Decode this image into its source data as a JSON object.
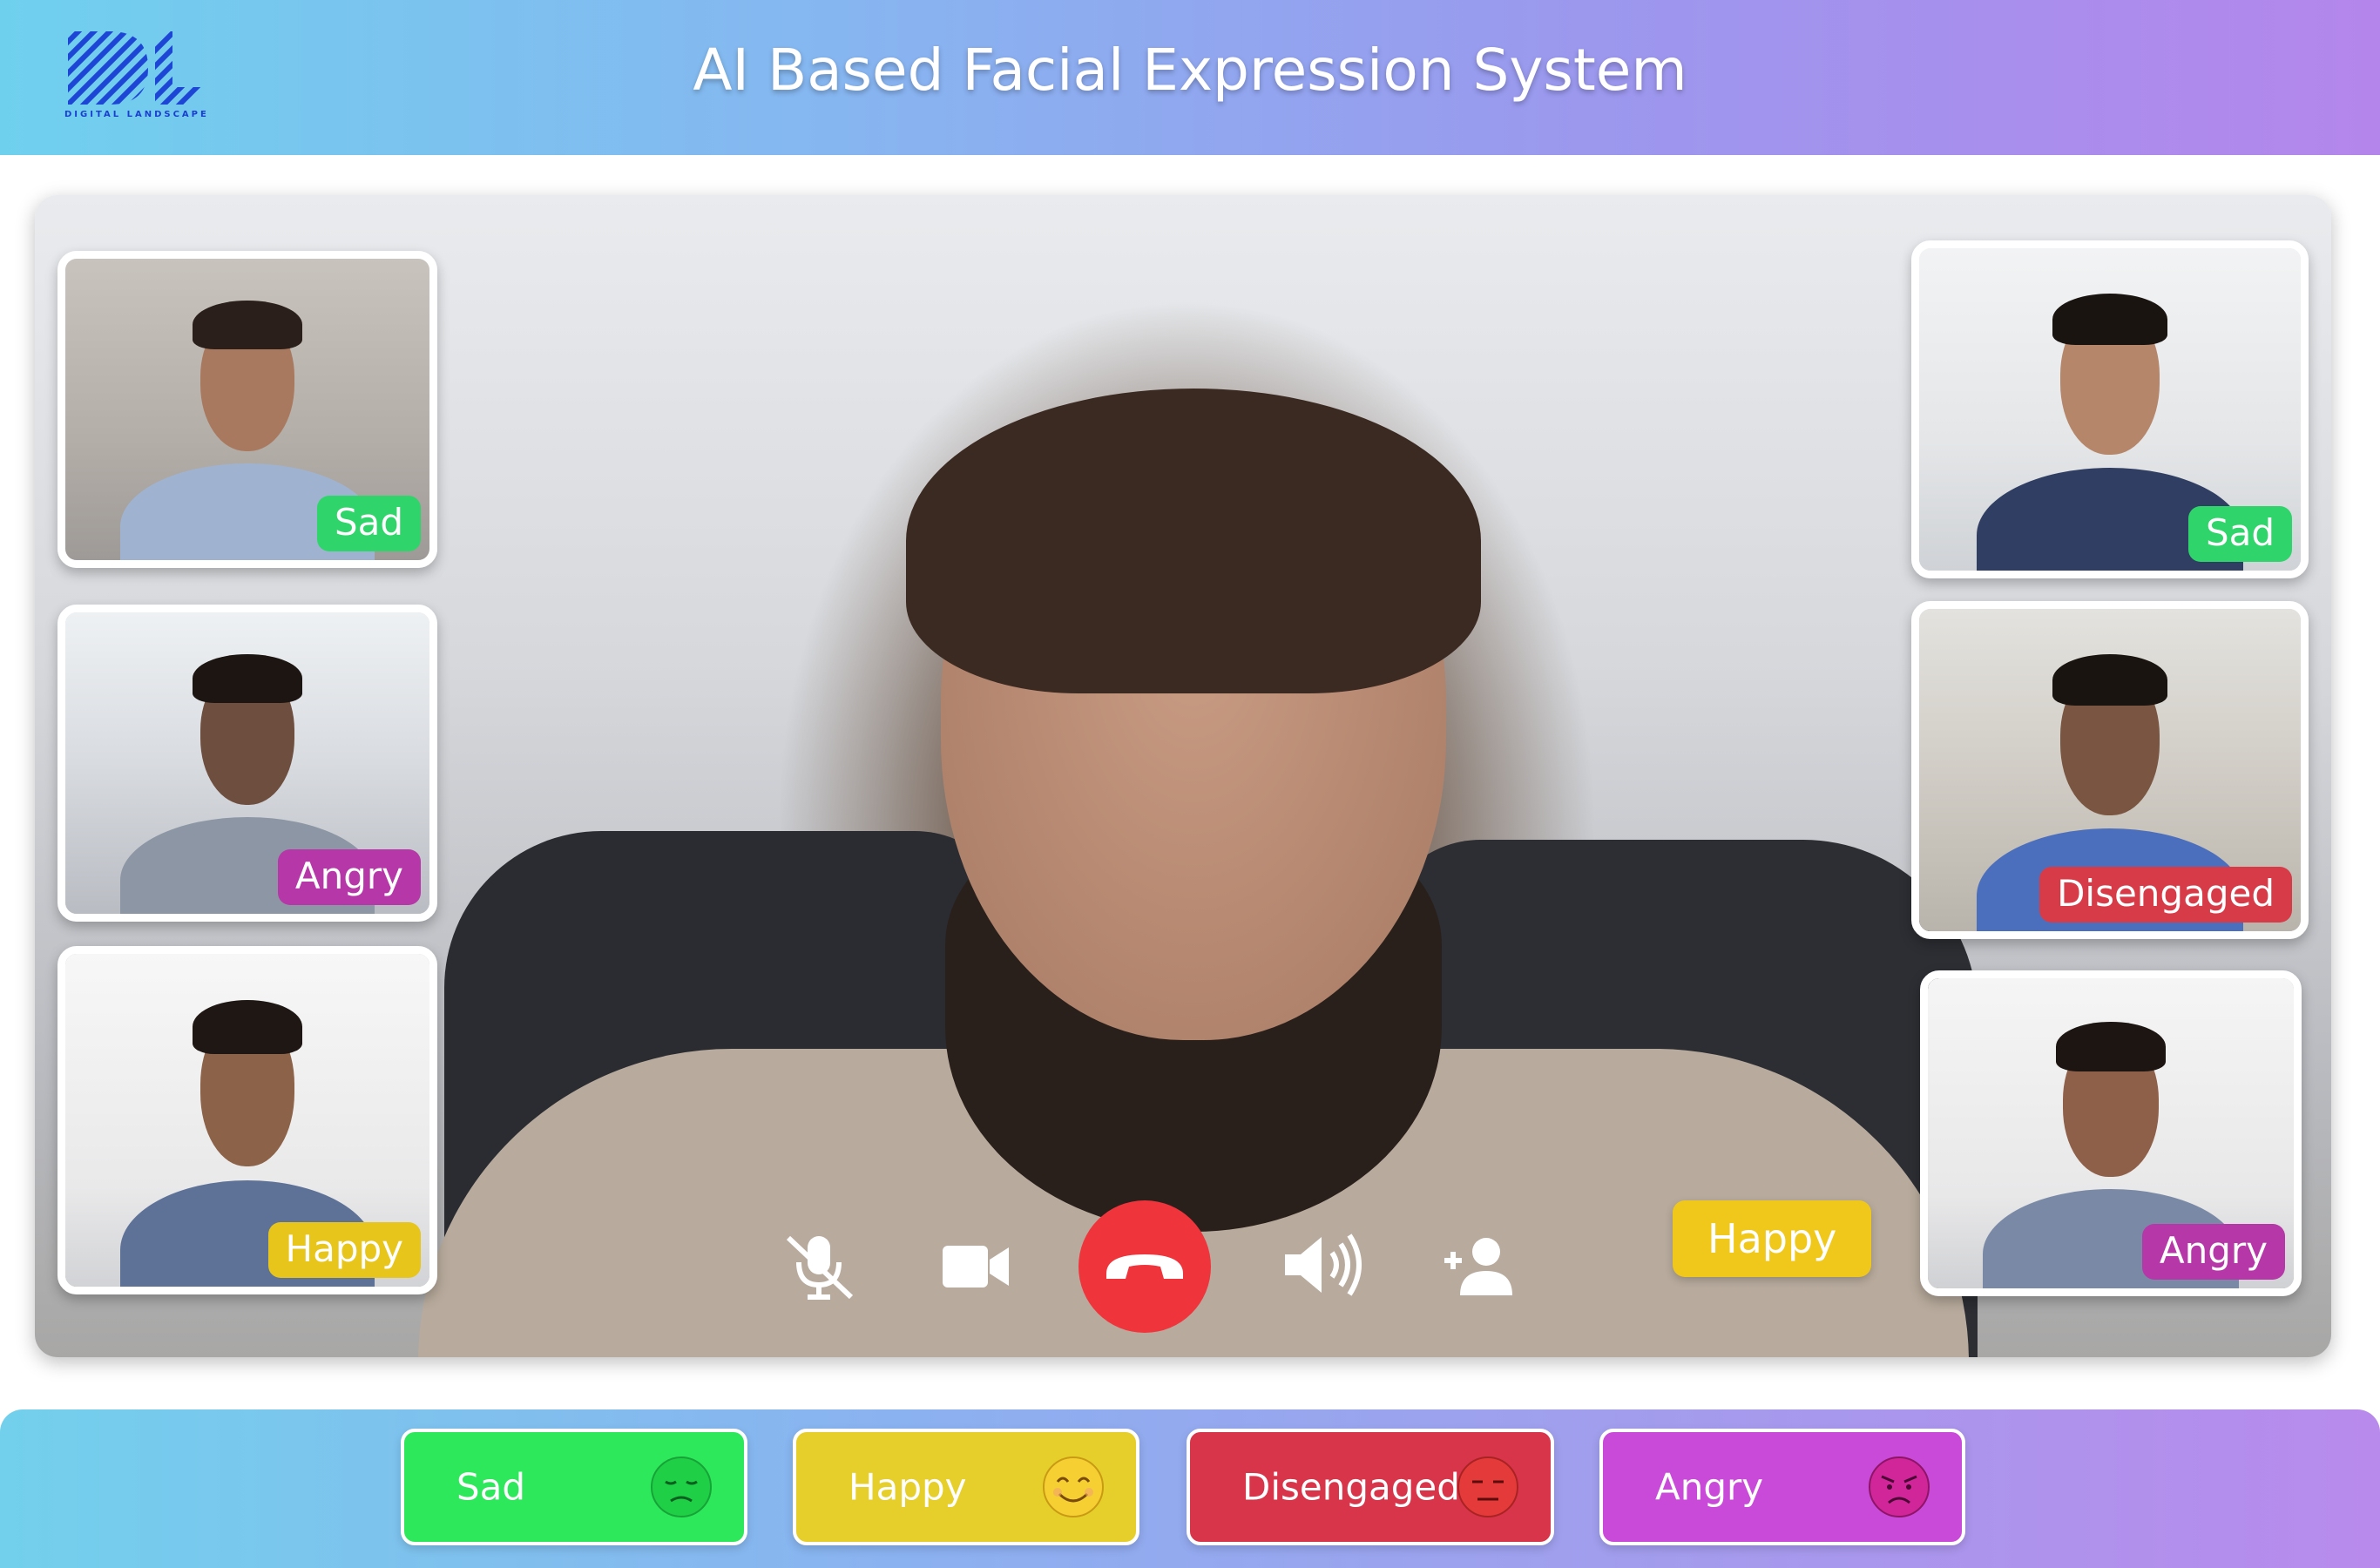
{
  "header": {
    "title": "AI Based Facial Expression System",
    "logo_text": "DIGITAL LANDSCAPE"
  },
  "participants_left": [
    {
      "label": "Sad",
      "status": "sad"
    },
    {
      "label": "Angry",
      "status": "angry"
    },
    {
      "label": "Happy",
      "status": "happy"
    }
  ],
  "participants_right": [
    {
      "label": "Sad",
      "status": "sad"
    },
    {
      "label": "Disengaged",
      "status": "disengaged"
    },
    {
      "label": "Angry",
      "status": "angry"
    }
  ],
  "main_video": {
    "label": "Happy",
    "status": "happy"
  },
  "controls": {
    "mute_icon": "mic-off-icon",
    "video_icon": "video-camera-icon",
    "end_call_icon": "phone-hangup-icon",
    "volume_icon": "volume-icon",
    "add_user_icon": "add-user-icon"
  },
  "legend": [
    {
      "label": "Sad",
      "icon": "sad-face-icon",
      "color": "#2ee85c"
    },
    {
      "label": "Happy",
      "icon": "smile-face-icon",
      "color": "#e6cf2a"
    },
    {
      "label": "Disengaged",
      "icon": "neutral-face-icon",
      "color": "#d8344a"
    },
    {
      "label": "Angry",
      "icon": "angry-face-icon",
      "color": "#c94ad8"
    }
  ],
  "colors": {
    "sad": "#2fd56a",
    "happy": "#e7c51a",
    "disengaged": "#d83b48",
    "angry": "#b638a8",
    "end_call": "#f0343c"
  }
}
